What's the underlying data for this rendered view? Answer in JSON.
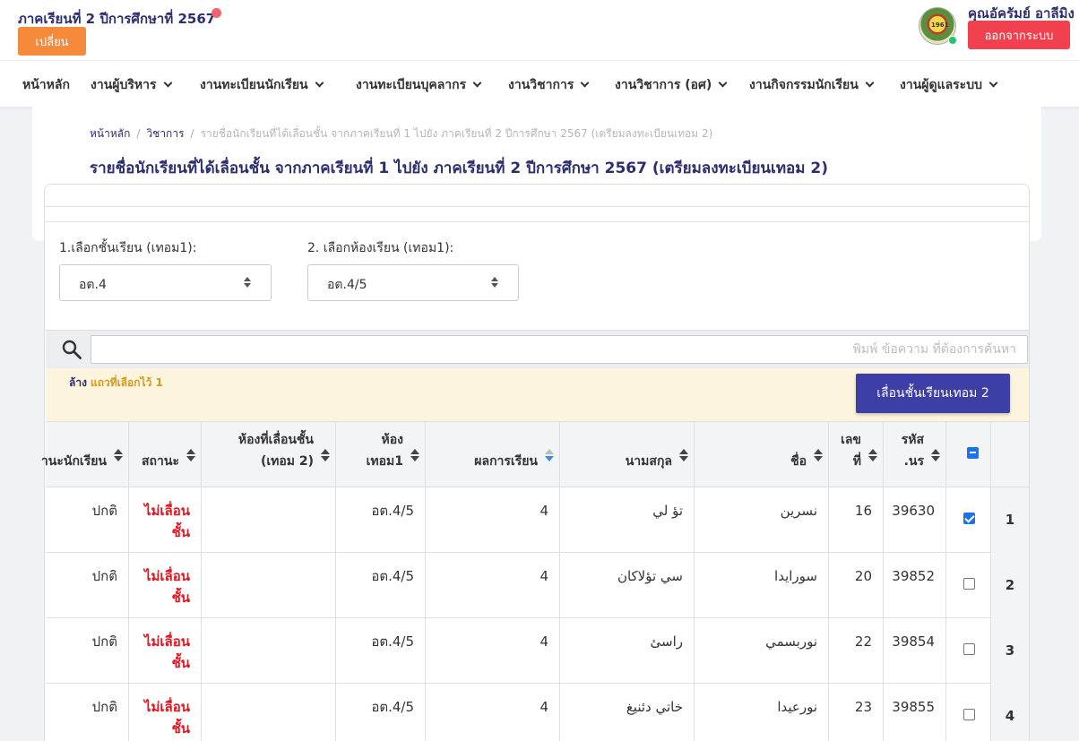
{
  "header": {
    "term_title": "ภาคเรียนที่ 2 ปีการศึกษาที่ 2567",
    "change_label": "เปลี่ยน",
    "logo_text": "1961",
    "user_name": "คุณอัครัมย์ อาลีมิง",
    "logout_label": "ออกจากระบบ"
  },
  "nav": [
    {
      "label": "หน้าหลัก"
    },
    {
      "label": "งานผู้บริหาร"
    },
    {
      "label": "งานทะเบียนนักเรียน"
    },
    {
      "label": "งานทะเบียนบุคลากร"
    },
    {
      "label": "งานวิชาการ"
    },
    {
      "label": "งานวิชาการ (อศ)"
    },
    {
      "label": "งานกิจกรรมนักเรียน"
    },
    {
      "label": "งานผู้ดูแลระบบ"
    }
  ],
  "breadcrumb": {
    "home": "หน้าหลัก",
    "section": "วิชาการ",
    "current": "รายชื่อนักเรียนที่ได้เลื่อนชั้น จากภาคเรียนที่ 1 ไปยัง ภาคเรียนที่ 2 ปีการศึกษา 2567 (เตรียมลงทะเบียนเทอม 2)"
  },
  "page_title": "รายชื่อนักเรียนที่ได้เลื่อนชั้น จากภาคเรียนที่ 1 ไปยัง ภาคเรียนที่ 2 ปีการศึกษา 2567 (เตรียมลงทะเบียนเทอม 2)",
  "filters": {
    "class_label": "1.เลือกชั้นเรียน (เทอม1):",
    "class_value": "อต.4",
    "room_label": "2. เลือกห้องเรียน (เทอม1):",
    "room_value": "อต.4/5"
  },
  "search": {
    "placeholder": "พิมพ์ ข้อความ ที่ต้องการค้นหา",
    "icon": "search-icon"
  },
  "selection": {
    "clear_label": "ล้าง",
    "selected_text": "แถวที่เลือกไว้ 1",
    "promote_label": "เลื่อนชั้นเรียนเทอม 2"
  },
  "table": {
    "columns": {
      "student_status": "านะนักเรียน",
      "status": "สถานะ",
      "new_room_l1": "ห้องที่เลื่อนชั้น",
      "new_room_l2": "(เทอม 2)",
      "room_l1": "ห้อง",
      "room_l2": "เทอม1",
      "result": "ผลการเรียน",
      "lastname": "นามสกุล",
      "firstname": "ชื่อ",
      "no_l1": "เลข",
      "no_l2": "ที่",
      "id_l1": "รหัส",
      "id_l2": ".นร"
    },
    "rows": [
      {
        "index": "1",
        "checked": true,
        "id": "39630",
        "no": "16",
        "firstname": "نسرين",
        "lastname": "تؤ لي",
        "result": "4",
        "room": "อต.4/5",
        "new_room": "",
        "status_l1": "ไม่เลื่อน",
        "status_l2": "ชั้น",
        "student_status": "ปกติ"
      },
      {
        "index": "2",
        "checked": false,
        "id": "39852",
        "no": "20",
        "firstname": "سورايدا",
        "lastname": "سي تؤلاكان",
        "result": "4",
        "room": "อต.4/5",
        "new_room": "",
        "status_l1": "ไม่เลื่อน",
        "status_l2": "ชั้น",
        "student_status": "ปกติ"
      },
      {
        "index": "3",
        "checked": false,
        "id": "39854",
        "no": "22",
        "firstname": "نوربسمي",
        "lastname": "راسئ",
        "result": "4",
        "room": "อต.4/5",
        "new_room": "",
        "status_l1": "ไม่เลื่อน",
        "status_l2": "ชั้น",
        "student_status": "ปกติ"
      },
      {
        "index": "4",
        "checked": false,
        "id": "39855",
        "no": "23",
        "firstname": "نورعيدا",
        "lastname": "خاتي دئنيغ",
        "result": "4",
        "room": "อต.4/5",
        "new_room": "",
        "status_l1": "ไม่เลื่อน",
        "status_l2": "ชั้น",
        "student_status": "ปกติ"
      }
    ]
  },
  "colors": {
    "brand": "#2c2e6f",
    "change_button": "#f58a3b",
    "logout_button": "#f2414e",
    "promote_button": "#3d3fa6",
    "status_red": "#e5141e",
    "online": "#20c56b"
  }
}
